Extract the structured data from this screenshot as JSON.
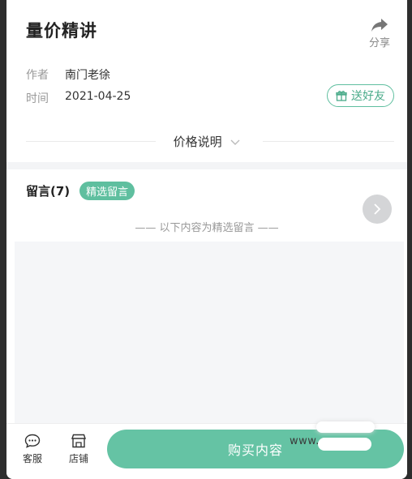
{
  "article": {
    "title": "量价精讲",
    "author_label": "作者",
    "author": "南门老徐",
    "date_label": "时间",
    "date": "2021-04-25"
  },
  "share": {
    "label": "分享",
    "icon": "share-icon"
  },
  "gift": {
    "label": "送好友",
    "icon": "gift-icon"
  },
  "price_note": {
    "label": "价格说明",
    "icon": "chevron-down-icon"
  },
  "comments": {
    "title": "留言(7)",
    "badge": "精选留言",
    "separator": "—— 以下内容为精选留言 ——"
  },
  "bottom_bar": {
    "service_label": "客服",
    "shop_label": "店铺",
    "buy_label": "购买内容"
  },
  "watermark": {
    "text": "www.        .com"
  },
  "colors": {
    "accent": "#65c3a4",
    "accent_text": "#4aab8a"
  }
}
